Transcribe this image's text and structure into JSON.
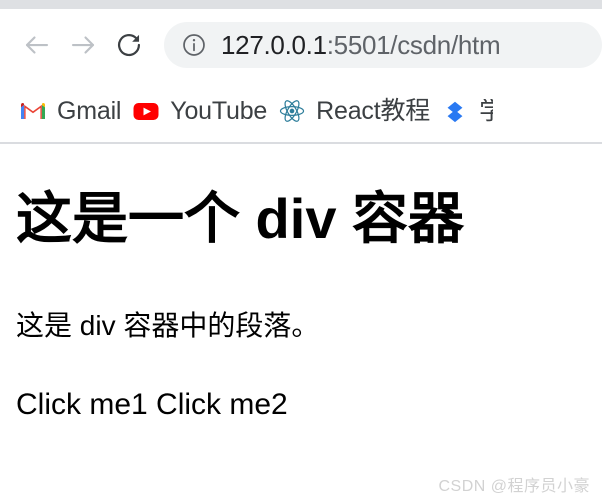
{
  "browser": {
    "nav": {
      "back_label": "Back",
      "forward_label": "Forward",
      "reload_label": "Reload"
    },
    "omnibox": {
      "site_info_label": "Site information",
      "url_host": "127.0.0.1",
      "url_rest": ":5501/csdn/htm",
      "full_url": "127.0.0.1:5501/csdn/htm"
    },
    "bookmarks": [
      {
        "label": "Gmail",
        "icon": "gmail-icon"
      },
      {
        "label": "YouTube",
        "icon": "youtube-icon"
      },
      {
        "label": "React教程",
        "icon": "react-icon"
      },
      {
        "label": "学",
        "icon": "double-chevron-down-icon"
      }
    ]
  },
  "page": {
    "heading": "这是一个 div 容器",
    "paragraph": "这是 div 容器中的段落。",
    "link1": "Click me1",
    "link_separator": " ",
    "link2": "Click me2",
    "watermark": "CSDN @程序员小豪"
  },
  "colors": {
    "tabstrip": "#dee0e3",
    "omnibox_bg": "#f1f3f4",
    "url_host_text": "#202124",
    "url_rest_text": "#5f6368",
    "bookmark_text": "#3c4043",
    "separator": "#dadce0",
    "page_text": "#000000",
    "watermark_text": "#d2d2d2",
    "youtube_red": "#ff0000",
    "react_blue": "#2d7d9a",
    "chevron_blue": "#2979f2"
  }
}
